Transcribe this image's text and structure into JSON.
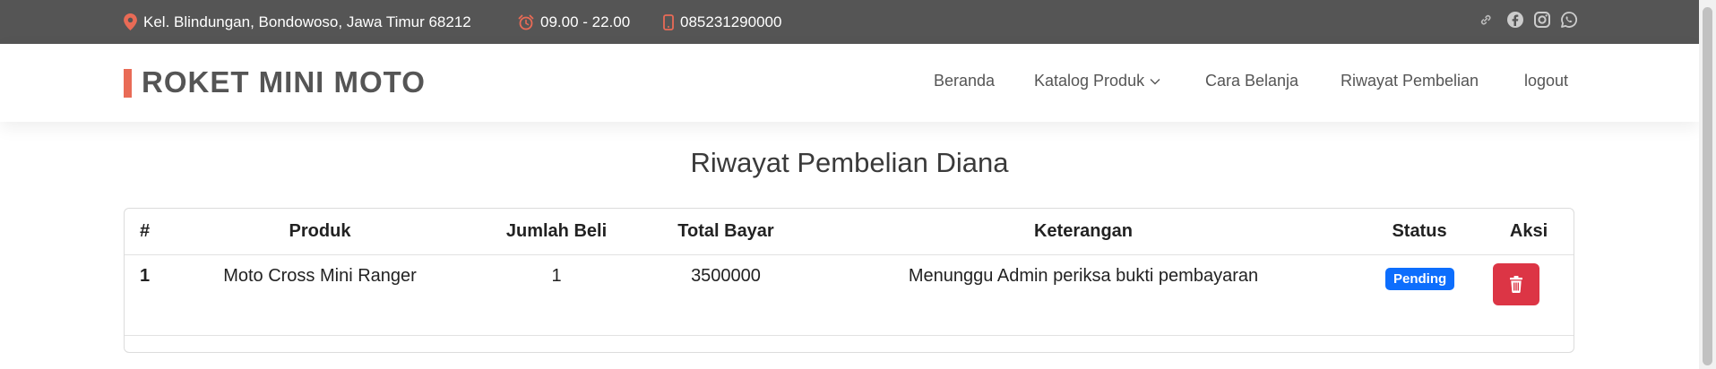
{
  "topbar": {
    "address": "Kel. Blindungan, Bondowoso, Jawa Timur 68212",
    "hours": "09.00 - 22.00",
    "phone": "085231290000",
    "icons": [
      "location-pin-icon",
      "alarm-clock-icon",
      "mobile-phone-icon",
      "link-icon",
      "facebook-icon",
      "instagram-icon",
      "whatsapp-icon"
    ],
    "accent_color": "#e96b56",
    "background_color": "#555555"
  },
  "header": {
    "brand": "ROKET MINI MOTO",
    "nav": [
      {
        "label": "Beranda"
      },
      {
        "label": "Katalog Produk",
        "has_dropdown": true
      },
      {
        "label": "Cara Belanja"
      },
      {
        "label": "Riwayat Pembelian"
      },
      {
        "label": "logout"
      }
    ]
  },
  "main": {
    "title": "Riwayat Pembelian Diana",
    "table": {
      "columns": [
        "#",
        "Produk",
        "Jumlah Beli",
        "Total Bayar",
        "Keterangan",
        "Status",
        "Aksi"
      ],
      "rows": [
        {
          "no": "1",
          "produk": "Moto Cross Mini Ranger",
          "jumlah": "1",
          "total": "3500000",
          "keterangan": "Menunggu Admin periksa bukti pembayaran",
          "status": "Pending",
          "action_icon": "trash-icon"
        }
      ]
    },
    "status_color": "#0d6efd",
    "delete_color": "#dc3545"
  }
}
